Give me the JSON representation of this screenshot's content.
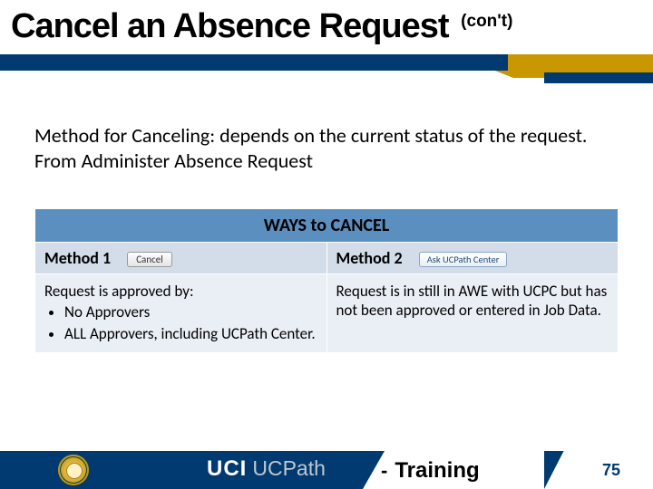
{
  "title": {
    "main": "Cancel an Absence Request",
    "cont": "(con't)"
  },
  "body": "Method for Canceling: depends on the current status of the request. From Administer Absence Request",
  "table": {
    "header": "WAYS to CANCEL",
    "m1_label": "Method 1",
    "m2_label": "Method 2",
    "btn_cancel": "Cancel",
    "btn_ask": "Ask UCPath Center",
    "m1_lead": "Request is approved by:",
    "m1_b1": "No Approvers",
    "m1_b2": "ALL Approvers, including UCPath Center.",
    "m2_desc": "Request is in still in AWE with UCPC but has not been approved or entered in Job Data."
  },
  "footer": {
    "uci": "UCI",
    "ucpath": "UCPath",
    "dash": "-",
    "training": "Training",
    "page": "75"
  }
}
